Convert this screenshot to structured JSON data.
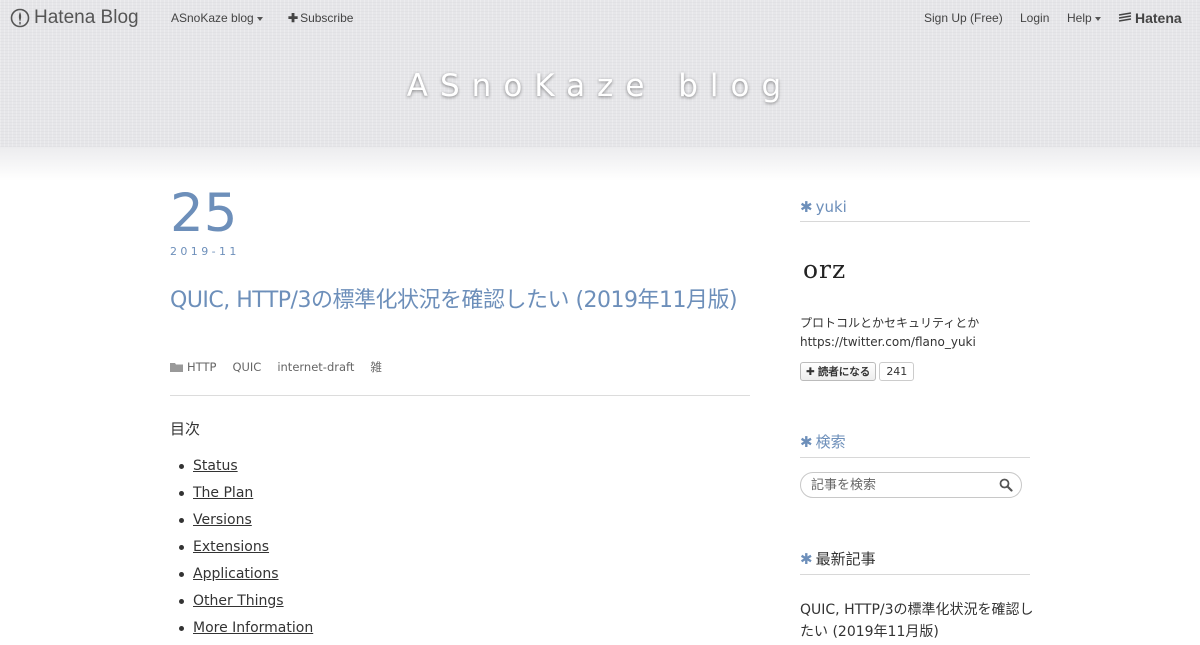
{
  "globalbar": {
    "logo_text": "Hatena Blog",
    "blog_menu_label": "ASnoKaze blog",
    "subscribe_label": "Subscribe",
    "signup_label": "Sign Up (Free)",
    "login_label": "Login",
    "help_label": "Help",
    "hatena_label": "Hatena",
    "icons": [
      "hatena-blog-logo-icon",
      "caret-down-icon",
      "plus-icon",
      "hatena-logo-icon"
    ]
  },
  "header": {
    "blog_title": "ASnoKaze blog"
  },
  "entry": {
    "day": "25",
    "year_month": "2019-11",
    "title": "QUIC, HTTP/3の標準化状況を確認したい (2019年11月版)",
    "categories": [
      "HTTP",
      "QUIC",
      "internet-draft",
      "雑"
    ],
    "toc_label": "目次",
    "toc": [
      "Status",
      "The Plan",
      "Versions",
      "Extensions",
      "Applications",
      "Other Things",
      "More Information"
    ]
  },
  "sidebar": {
    "profile": {
      "heading": "yuki",
      "image_text": "orz",
      "description": "プロトコルとかセキュリティとか",
      "link": "https://twitter.com/flano_yuki",
      "follow_label": "読者になる",
      "follow_count": "241"
    },
    "search": {
      "heading": "検索",
      "placeholder": "記事を検索"
    },
    "recent": {
      "heading": "最新記事",
      "items": [
        "QUIC, HTTP/3の標準化状況を確認したい (2019年11月版)"
      ]
    }
  },
  "colors": {
    "accent": "#6d8fba",
    "header_bg": "#e6e6e9",
    "text": "#333333"
  }
}
